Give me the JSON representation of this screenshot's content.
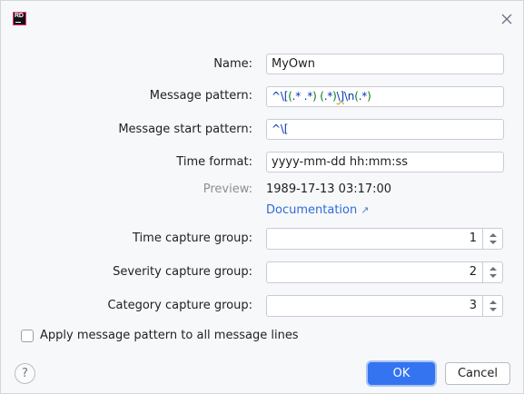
{
  "window": {
    "logo_text": "RD",
    "icons": {
      "logo": "rider-logo-icon",
      "close": "close-icon"
    }
  },
  "form": {
    "name_label": "Name:",
    "name_value": "MyOwn",
    "message_pattern_label": "Message pattern:",
    "message_pattern_value": "^\\[(.* .*) (.*)\\]\\n(.*)",
    "message_pattern_tokens": [
      {
        "text": "^",
        "style": "b"
      },
      {
        "text": "\\[",
        "style": "b"
      },
      {
        "text": "(",
        "style": "g"
      },
      {
        "text": ".* .*",
        "style": "b"
      },
      {
        "text": ")",
        "style": "g"
      },
      {
        "text": " ",
        "style": "n"
      },
      {
        "text": "(",
        "style": "g"
      },
      {
        "text": ".*",
        "style": "b"
      },
      {
        "text": ")",
        "style": "g"
      },
      {
        "text": "\\]",
        "style": "u"
      },
      {
        "text": "\\n",
        "style": "b"
      },
      {
        "text": "(",
        "style": "g"
      },
      {
        "text": ".*",
        "style": "b"
      },
      {
        "text": ")",
        "style": "g"
      }
    ],
    "message_start_label": "Message start pattern:",
    "message_start_value": "^\\[",
    "time_format_label": "Time format:",
    "time_format_value": "yyyy-mm-dd hh:mm:ss",
    "preview_label": "Preview:",
    "preview_value": "1989-17-13 03:17:00",
    "documentation_link": "Documentation",
    "documentation_arrow": "↗",
    "time_group_label": "Time capture group:",
    "time_group_value": "1",
    "severity_group_label": "Severity capture group:",
    "severity_group_value": "2",
    "category_group_label": "Category capture group:",
    "category_group_value": "3",
    "apply_all_label": "Apply message pattern to all message lines",
    "apply_all_checked": false
  },
  "footer": {
    "help_label": "?",
    "ok_label": "OK",
    "cancel_label": "Cancel"
  },
  "colors": {
    "accent": "#3574f0",
    "link": "#2f6bd9",
    "regex_group": "#067d17",
    "regex_escape": "#0033b3"
  }
}
